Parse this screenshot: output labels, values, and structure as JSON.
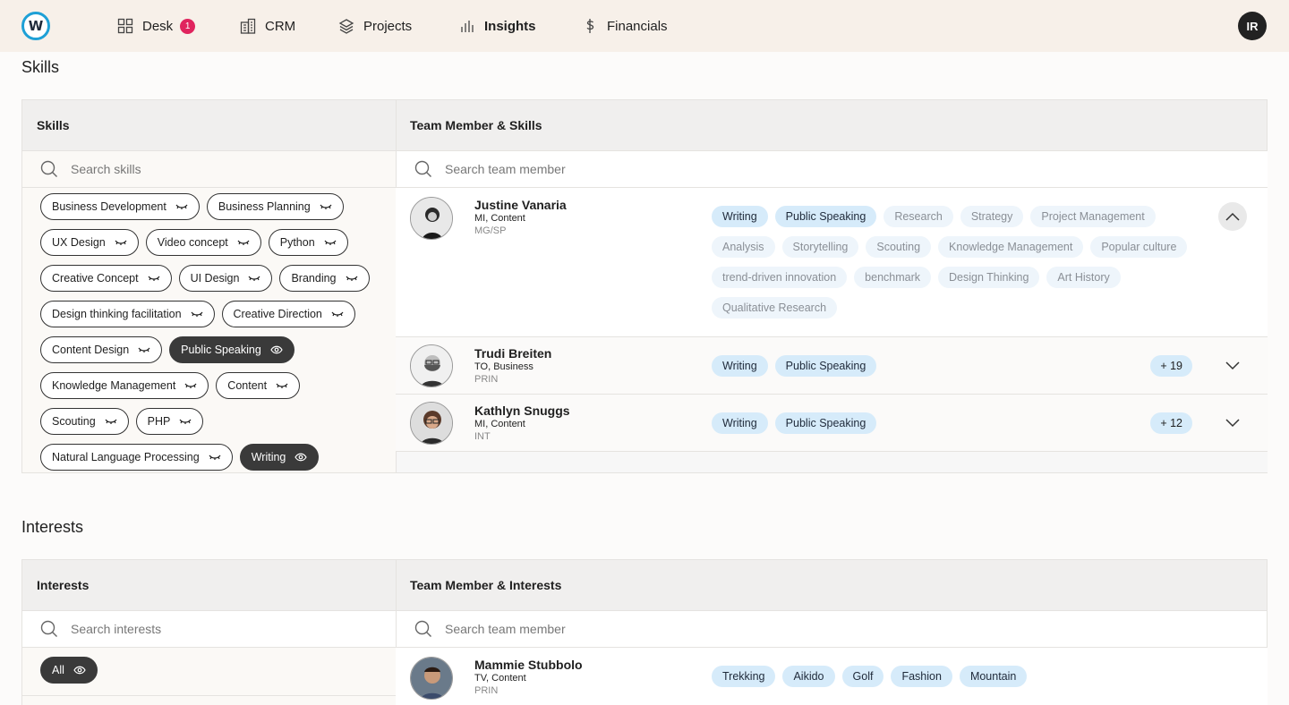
{
  "nav": {
    "logo_letter": "W",
    "items": [
      {
        "label": "Desk",
        "icon": "grid-icon",
        "badge": "1"
      },
      {
        "label": "CRM",
        "icon": "building-icon"
      },
      {
        "label": "Projects",
        "icon": "layers-icon"
      },
      {
        "label": "Insights",
        "icon": "bar-chart-icon",
        "active": true
      },
      {
        "label": "Financials",
        "icon": "dollar-icon"
      }
    ],
    "user_initials": "IR"
  },
  "skills_section": {
    "title": "Skills",
    "left_header": "Skills",
    "right_header": "Team Member & Skills",
    "skills_search_placeholder": "Search skills",
    "member_search_placeholder": "Search team member",
    "skills": [
      {
        "label": "Business Development",
        "selected": false
      },
      {
        "label": "Business Planning",
        "selected": false
      },
      {
        "label": "UX Design",
        "selected": false
      },
      {
        "label": "Video concept",
        "selected": false
      },
      {
        "label": "Python",
        "selected": false
      },
      {
        "label": "Creative Concept",
        "selected": false
      },
      {
        "label": "UI Design",
        "selected": false
      },
      {
        "label": "Branding",
        "selected": false
      },
      {
        "label": "Design thinking facilitation",
        "selected": false
      },
      {
        "label": "Creative Direction",
        "selected": false
      },
      {
        "label": "Content Design",
        "selected": false
      },
      {
        "label": "Public Speaking",
        "selected": true
      },
      {
        "label": "Knowledge Management",
        "selected": false
      },
      {
        "label": "Content",
        "selected": false
      },
      {
        "label": "Scouting",
        "selected": false
      },
      {
        "label": "PHP",
        "selected": false
      },
      {
        "label": "Natural Language Processing",
        "selected": false
      },
      {
        "label": "Writing",
        "selected": true
      }
    ],
    "members": [
      {
        "name": "Justine Vanaria",
        "role": "MI, Content",
        "code": "MG/SP",
        "primary_tags": [
          "Writing",
          "Public Speaking"
        ],
        "other_tags": [
          "Research",
          "Strategy",
          "Project Management",
          "Analysis",
          "Storytelling",
          "Scouting",
          "Knowledge Management",
          "Popular culture",
          "trend-driven innovation",
          "benchmark",
          "Design Thinking",
          "Art History",
          "Qualitative Research"
        ],
        "expanded": true
      },
      {
        "name": "Trudi Breiten",
        "role": "TO, Business",
        "code": "PRIN",
        "primary_tags": [
          "Writing",
          "Public Speaking"
        ],
        "more": "+ 19",
        "expanded": false
      },
      {
        "name": "Kathlyn Snuggs",
        "role": "MI, Content",
        "code": "INT",
        "primary_tags": [
          "Writing",
          "Public Speaking"
        ],
        "more": "+ 12",
        "expanded": false
      }
    ]
  },
  "interests_section": {
    "title": "Interests",
    "left_header": "Interests",
    "right_header": "Team Member & Interests",
    "interests_search_placeholder": "Search interests",
    "member_search_placeholder": "Search team member",
    "all_chip": "All",
    "members": [
      {
        "name": "Mammie Stubbolo",
        "role": "TV, Content",
        "code": "PRIN",
        "tags": [
          "Trekking",
          "Aikido",
          "Golf",
          "Fashion",
          "Mountain"
        ]
      }
    ]
  }
}
